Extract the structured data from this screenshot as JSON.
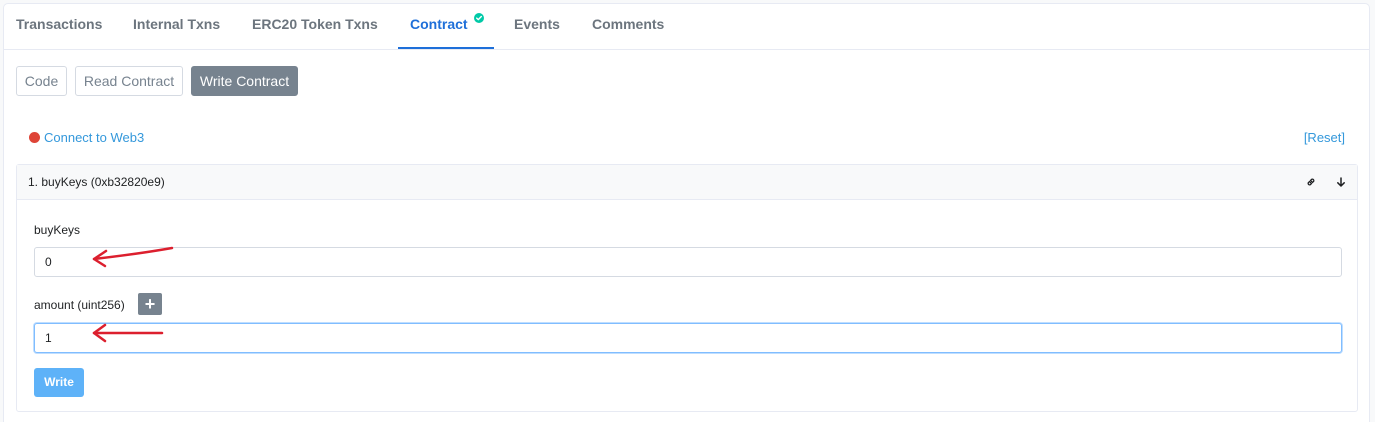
{
  "tabs": [
    {
      "label": "Transactions",
      "active": false
    },
    {
      "label": "Internal Txns",
      "active": false
    },
    {
      "label": "ERC20 Token Txns",
      "active": false
    },
    {
      "label": "Contract",
      "active": true,
      "icon": "verified-check-icon"
    },
    {
      "label": "Events",
      "active": false
    },
    {
      "label": "Comments",
      "active": false
    }
  ],
  "contract_tabs": {
    "code": "Code",
    "read": "Read Contract",
    "write": "Write Contract",
    "active": "Write Contract"
  },
  "web3": {
    "connect_label": "Connect to Web3",
    "status_color": "#de4437",
    "reset_label": "[Reset]"
  },
  "method": {
    "title": "1. buyKeys (0xb32820e9)",
    "icons": [
      "link-icon",
      "arrow-down-icon"
    ],
    "payable_label": "buyKeys",
    "payable_value": "0",
    "param_label": "amount (uint256)",
    "param_value": "1",
    "add_icon": "plus-icon",
    "write_label": "Write"
  },
  "annotations": {
    "arrow_color": "#dc1f2e"
  }
}
